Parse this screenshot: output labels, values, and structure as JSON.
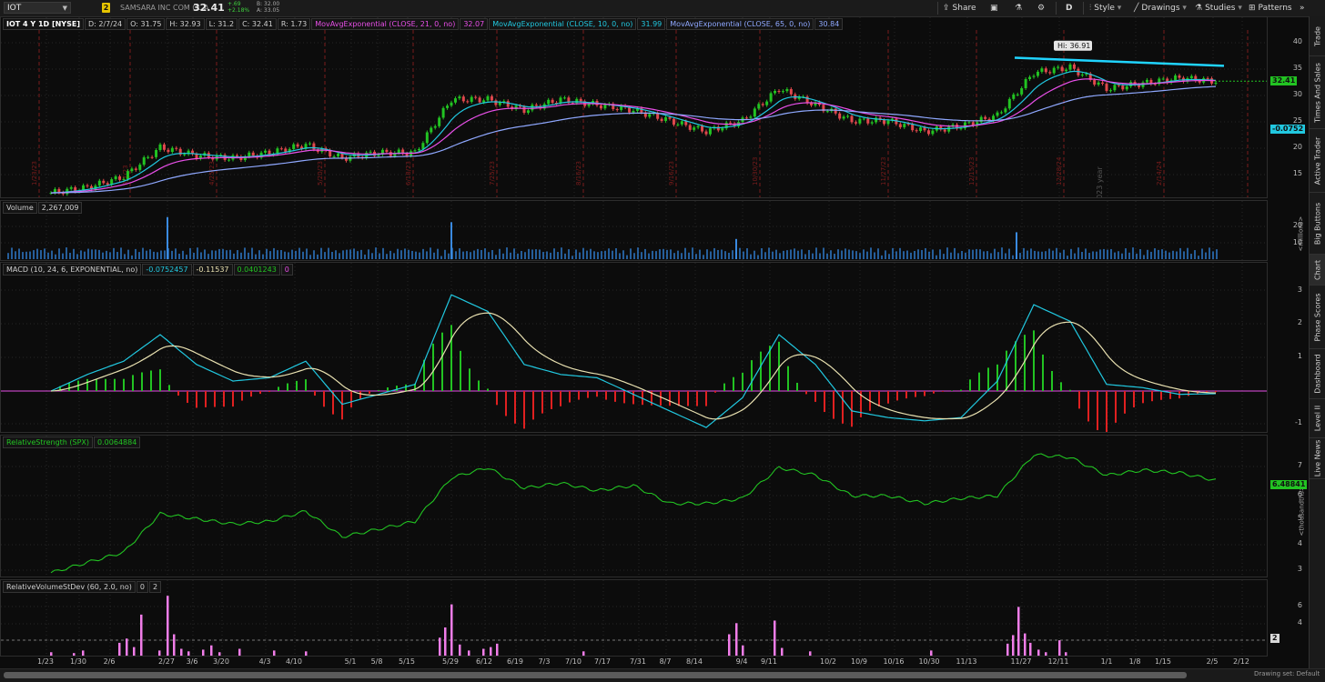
{
  "header": {
    "symbol": "IOT",
    "link_badge": "2",
    "company": "SAMSARA INC COM CL A",
    "last": "32.41",
    "change": "+.69",
    "change_pct": "+2.18%",
    "bid": "B: 32.00",
    "ask": "A: 33.05",
    "toolbar": {
      "share": "Share",
      "aggregation": "D",
      "style": "Style",
      "drawings": "Drawings",
      "studies": "Studies",
      "patterns": "Patterns"
    }
  },
  "price_pane": {
    "legend": {
      "title": "IOT 4 Y 1D [NYSE]",
      "date": "D: 2/7/24",
      "open": "O: 31.75",
      "high": "H: 32.93",
      "low": "L: 31.2",
      "close": "C: 32.41",
      "range": "R: 1.73",
      "ma21_label": "MovAvgExponential (CLOSE, 21, 0, no)",
      "ma21_value": "32.07",
      "ma10_label": "MovAvgExponential (CLOSE, 10, 0, no)",
      "ma10_value": "31.99",
      "ma65_label": "MovAvgExponential (CLOSE, 65, 0, no)",
      "ma65_value": "30.84"
    },
    "y_ticks": [
      "40",
      "35",
      "30",
      "25",
      "20",
      "15"
    ],
    "last_price_tag": "32.41",
    "hi_bubble": "Hi: 36.91",
    "year_marker": "2023 year",
    "earnings_dates": [
      "1/23/23",
      "3/7/23",
      "4/25/23",
      "5/20/23",
      "6/18/23",
      "7/25/23",
      "8/16/23",
      "9/16/23",
      "10/30/23",
      "11/27/23",
      "12/15/23",
      "12/28/24",
      "2/14/24"
    ],
    "colors": {
      "up": "#22c322",
      "down": "#e0484d",
      "ema10": "#21c8e0",
      "ema21": "#e84fe8",
      "ema65": "#8fa8ff",
      "trendline": "#20d4ff"
    }
  },
  "volume_pane": {
    "label": "Volume",
    "value": "2,267,009",
    "y_ticks": [
      "20",
      "10"
    ],
    "unit": "<millions>"
  },
  "macd_pane": {
    "label": "MACD (10, 24, 6, EXPONENTIAL, no)",
    "value": "-0.0752457",
    "avg": "-0.11537",
    "diff": "0.0401243",
    "zero": "0",
    "y_ticks": [
      "3",
      "2",
      "1",
      "-1"
    ],
    "last_tag": "-0.0752"
  },
  "rs_pane": {
    "label": "RelativeStrength (SPX)",
    "value": "0.0064884",
    "y_ticks": [
      "7",
      "6",
      "5",
      "4",
      "3"
    ],
    "last_tag": "6.48841",
    "unit": "<thousandths>"
  },
  "rvol_pane": {
    "label": "RelativeVolumeStDev (60, 2.0, no)",
    "value": "0",
    "threshold": "2",
    "y_ticks": [
      "6",
      "4",
      "2"
    ],
    "threshold_tag": "2"
  },
  "x_axis": [
    "1/23",
    "1/30",
    "2/6",
    "2/27",
    "3/6",
    "3/20",
    "4/3",
    "4/10",
    "5/1",
    "5/8",
    "5/15",
    "5/29",
    "6/12",
    "6/19",
    "7/3",
    "7/10",
    "7/17",
    "7/31",
    "8/7",
    "8/14",
    "9/4",
    "9/11",
    "10/2",
    "10/9",
    "10/16",
    "10/30",
    "11/13",
    "11/27",
    "12/11",
    "1/1",
    "1/8",
    "1/15",
    "2/5",
    "2/12"
  ],
  "side_tabs": [
    "Trade",
    "Times And Sales",
    "Active Trader",
    "Big Buttons",
    "Chart",
    "Phase Scores",
    "Dashboard",
    "Level II",
    "Live News"
  ],
  "bottom": {
    "drawing_set": "Drawing set: Default"
  },
  "chart_data": {
    "type": "line",
    "price_x_dates": [
      "1/23",
      "1/30",
      "2/6",
      "2/27",
      "3/6",
      "3/20",
      "4/3",
      "4/10",
      "5/1",
      "5/8",
      "5/15",
      "5/29",
      "6/12",
      "6/19",
      "7/3",
      "7/10",
      "7/17",
      "7/31",
      "8/7",
      "8/14",
      "9/4",
      "9/11",
      "10/2",
      "10/9",
      "10/16",
      "10/30",
      "11/13",
      "11/27",
      "12/11",
      "1/1",
      "1/8",
      "1/15",
      "2/5"
    ],
    "price_close": [
      11.5,
      12.5,
      14.5,
      20,
      18.5,
      18,
      19,
      20.5,
      18,
      19,
      19,
      29,
      29,
      27,
      29,
      28,
      27,
      25,
      23,
      25,
      31,
      28,
      25,
      25,
      23,
      24,
      26,
      34,
      35,
      31,
      32,
      33,
      32.4
    ],
    "ylim": [
      11,
      42
    ],
    "high_marker": 36.91,
    "rs_values": [
      2.9,
      3.3,
      3.7,
      5.2,
      5,
      4.8,
      4.9,
      5.3,
      4.3,
      4.6,
      4.9,
      6.6,
      7,
      6.2,
      6.4,
      6.1,
      6.3,
      5.6,
      5.6,
      5.8,
      7,
      6.7,
      5.9,
      5.9,
      5.6,
      5.8,
      5.9,
      7.5,
      7.4,
      6.7,
      6.9,
      6.8,
      6.5
    ],
    "macd_values": [
      0,
      0.5,
      0.9,
      1.7,
      0.8,
      0.3,
      0.4,
      0.9,
      -0.4,
      -0.1,
      0.2,
      2.9,
      2.4,
      0.8,
      0.5,
      0.4,
      -0.1,
      -0.6,
      -1.1,
      -0.2,
      1.7,
      0.8,
      -0.6,
      -0.8,
      -0.9,
      -0.8,
      0.3,
      2.6,
      2.1,
      0.2,
      0.1,
      -0.1,
      -0.08
    ],
    "volume_spikes_millions": [
      {
        "x": "2/27",
        "v": 25
      },
      {
        "x": "5/29",
        "v": 22
      },
      {
        "x": "9/4",
        "v": 12
      },
      {
        "x": "11/27",
        "v": 16
      }
    ]
  }
}
